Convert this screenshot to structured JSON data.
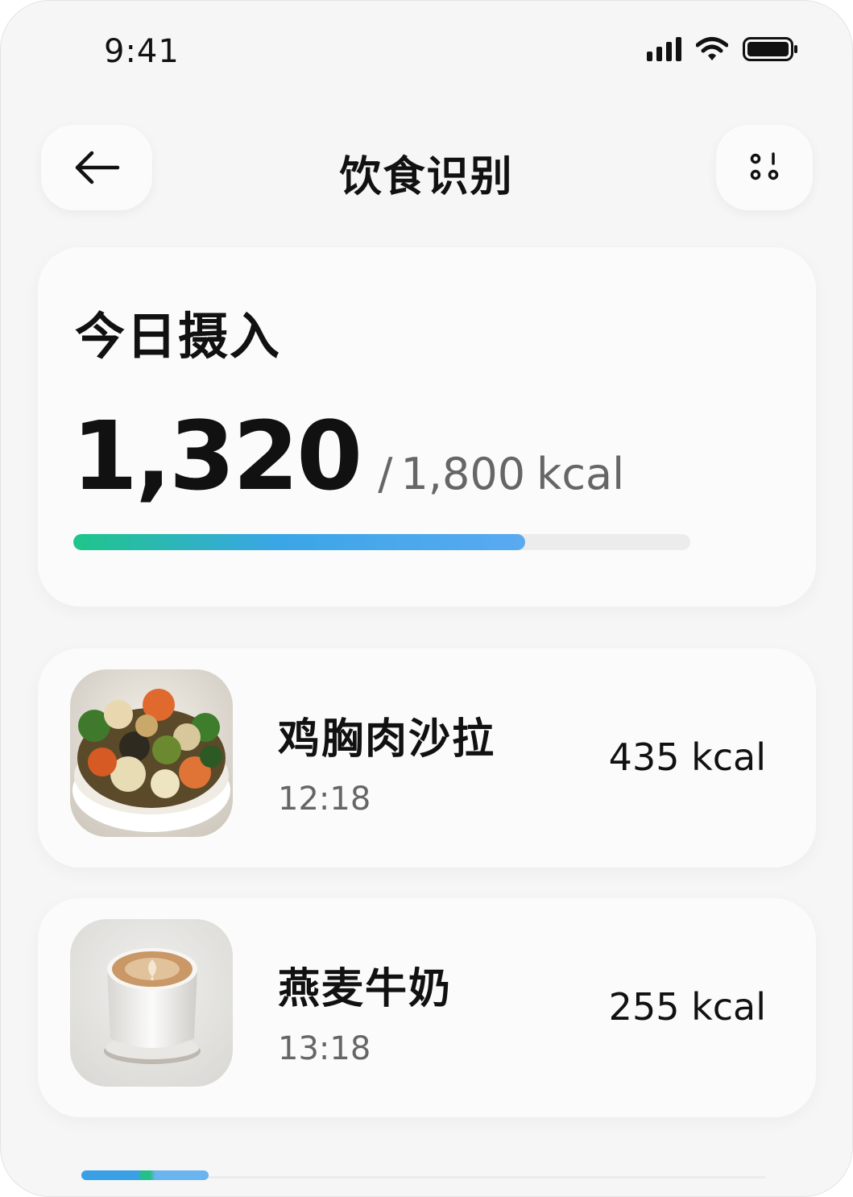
{
  "status_bar": {
    "time": "9:41"
  },
  "header": {
    "title": "饮食识别"
  },
  "summary": {
    "title": "今日摄入",
    "current": "1,320",
    "separator": "/",
    "goal": "1,800",
    "unit": "kcal",
    "progress": 0.733
  },
  "meals": [
    {
      "name": "鸡胸肉沙拉",
      "time": "12:18",
      "kcal": "435 kcal",
      "image": "salad-bowl"
    },
    {
      "name": "燕麦牛奶",
      "time": "13:18",
      "kcal": "255 kcal",
      "image": "latte-cup"
    }
  ],
  "colors": {
    "progress_start": "#1fc58a",
    "progress_end": "#5aaaf0",
    "background": "#f6f6f6"
  },
  "icons": {
    "back": "arrow-left-icon",
    "more": "dots-menu-icon"
  }
}
